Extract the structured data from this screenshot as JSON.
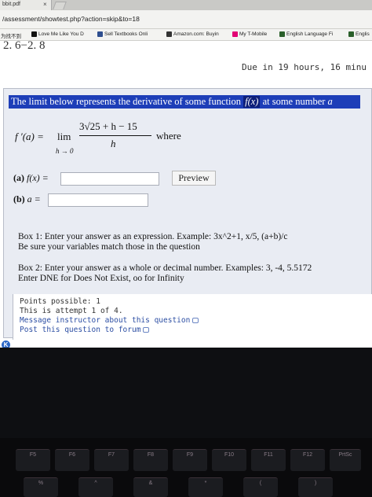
{
  "browser": {
    "tab_title": "bbit.pdf",
    "tab_close": "×",
    "url": "/assessment/showtest.php?action=skip&to=18",
    "bookmarks": [
      {
        "label": "为找不到",
        "color": "#c0392b"
      },
      {
        "label": "Love Me Like You D",
        "color": "#111111"
      },
      {
        "label": "Sell Textbooks Onli",
        "color": "#2e4e8f"
      },
      {
        "label": "Amazon.com: Buyin",
        "color": "#333333"
      },
      {
        "label": "My T-Mobile",
        "color": "#e20074"
      },
      {
        "label": "English Language Fi",
        "color": "#2a5f2a"
      },
      {
        "label": "Englis",
        "color": "#2a5f2a"
      }
    ]
  },
  "page": {
    "prev_score": "2. 6−2. 8",
    "due": "Due in 19 hours, 16 minu",
    "question": {
      "title_prefix": "The limit below represents the derivative of some function",
      "title_fx": "f(x)",
      "title_mid": "at some number",
      "title_var": "a",
      "formula": {
        "lhs": "f ′(a)  =",
        "lim": "lim",
        "sub": "h → 0",
        "numerator": "3√25 + h  −  15",
        "denominator": "h",
        "where": "where"
      },
      "part_a_label": "(a)",
      "part_a_var": "f(x) =",
      "part_a_value": "",
      "preview_label": "Preview",
      "part_b_label": "(b)",
      "part_b_var": "a =",
      "part_b_value": "",
      "box1_line1": "Box 1: Enter your answer as an expression. Example: 3x^2+1, x/5, (a+b)/c",
      "box1_line2": "Be sure your variables match those in the question",
      "box2_line1": "Box 2: Enter your answer as a whole or decimal number. Examples: 3, -4, 5.5172",
      "box2_line2": "Enter DNE for Does Not Exist, oo for Infinity"
    },
    "info": {
      "points": "Points possible: 1",
      "attempt": "This is attempt 1 of 4.",
      "message_link": "Message instructor about this question",
      "forum_link": "Post this question to forum"
    },
    "badge": "K"
  },
  "keyboard": {
    "keys": [
      "F5",
      "F6",
      "F7",
      "F8",
      "F9",
      "F10",
      "F11",
      "F12",
      "PrtSc"
    ],
    "lower_keys": [
      "%",
      "^",
      "&",
      "*",
      "(",
      ")"
    ]
  }
}
